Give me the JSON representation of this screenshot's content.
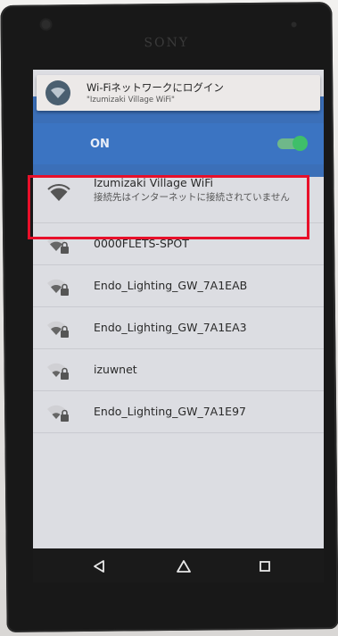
{
  "device": {
    "brand": "SONY"
  },
  "notification": {
    "title": "Wi-Fiネットワークにログイン",
    "subtitle": "\"Izumizaki Village WiFi\"",
    "icon": "wifi-icon"
  },
  "wifi_toggle": {
    "label": "ON",
    "state": "on",
    "accent": "#3fbf6a"
  },
  "networks": [
    {
      "ssid": "Izumizaki Village WiFi",
      "status": "接続先はインターネットに接続されていません",
      "secured": false,
      "highlighted": true
    },
    {
      "ssid": "0000FLETS-SPOT",
      "secured": true
    },
    {
      "ssid": "Endo_Lighting_GW_7A1EAB",
      "secured": true
    },
    {
      "ssid": "Endo_Lighting_GW_7A1EA3",
      "secured": true
    },
    {
      "ssid": "izuwnet",
      "secured": true
    },
    {
      "ssid": "Endo_Lighting_GW_7A1E97",
      "secured": true
    }
  ],
  "navbar": {
    "back_icon": "back-triangle-icon",
    "home_icon": "home-icon",
    "recents_icon": "recents-square-icon"
  },
  "colors": {
    "header_blue": "#3b74c2",
    "highlight_red": "#e8102a"
  }
}
